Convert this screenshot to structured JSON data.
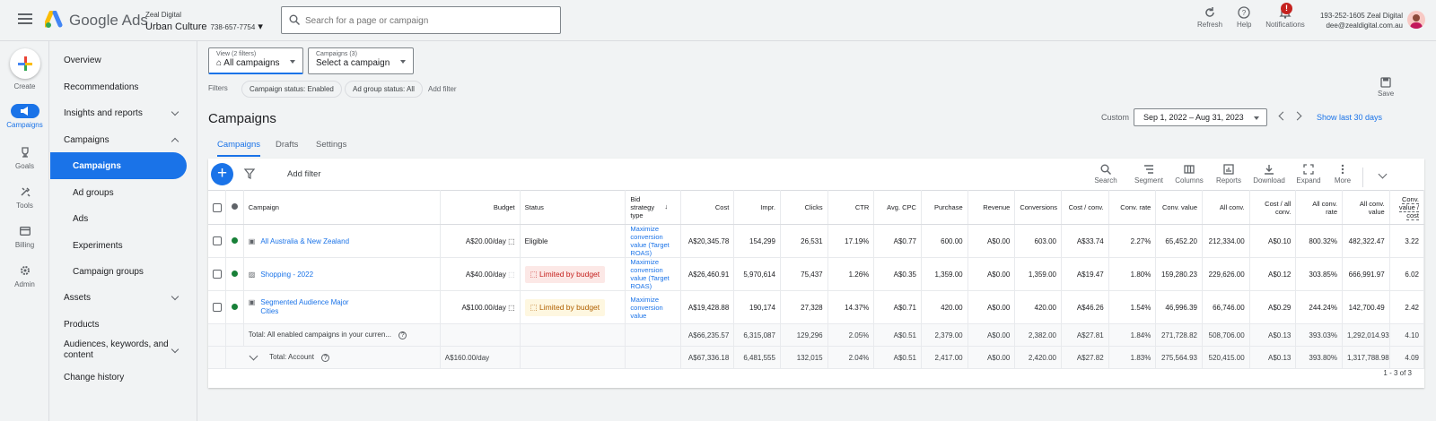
{
  "app": {
    "name": "Google Ads"
  },
  "account": {
    "manager": "Zeal Digital",
    "name": "Urban Culture",
    "id": "738-657-7754"
  },
  "search": {
    "placeholder": "Search for a page or campaign"
  },
  "topbar": {
    "refresh": "Refresh",
    "help": "Help",
    "notifications": "Notifications",
    "notif_count": "!"
  },
  "user": {
    "line1": "193-252-1605 Zeal Digital",
    "line2": "dee@zealdigital.com.au"
  },
  "rail": {
    "create": "Create",
    "campaigns": "Campaigns",
    "goals": "Goals",
    "tools": "Tools",
    "billing": "Billing",
    "admin": "Admin"
  },
  "nav": {
    "overview": "Overview",
    "recommendations": "Recommendations",
    "insights": "Insights and reports",
    "campaigns": "Campaigns",
    "campaigns_sub": "Campaigns",
    "ad_groups": "Ad groups",
    "ads": "Ads",
    "experiments": "Experiments",
    "campaign_groups": "Campaign groups",
    "assets": "Assets",
    "products": "Products",
    "audiences": "Audiences, keywords, and content",
    "change_history": "Change history"
  },
  "view": {
    "label": "View (2 filters)",
    "value": "All campaigns"
  },
  "campaign_select": {
    "label": "Campaigns (3)",
    "value": "Select a campaign"
  },
  "filters": {
    "label": "Filters",
    "chip1": "Campaign status: Enabled",
    "chip2": "Ad group status: All",
    "add": "Add filter"
  },
  "save": "Save",
  "page": {
    "title": "Campaigns"
  },
  "date": {
    "custom": "Custom",
    "range": "Sep 1, 2022 – Aug 31, 2023",
    "show_last": "Show last 30 days"
  },
  "tabs": {
    "campaigns": "Campaigns",
    "drafts": "Drafts",
    "settings": "Settings"
  },
  "toolbar": {
    "add_filter": "Add filter",
    "search": "Search",
    "segment": "Segment",
    "columns": "Columns",
    "reports": "Reports",
    "download": "Download",
    "expand": "Expand",
    "more": "More"
  },
  "columns": {
    "campaign": "Campaign",
    "budget": "Budget",
    "status": "Status",
    "bid": "Bid strategy type",
    "cost": "Cost",
    "impr": "Impr.",
    "clicks": "Clicks",
    "ctr": "CTR",
    "avg_cpc": "Avg. CPC",
    "purchase": "Purchase",
    "revenue": "Revenue",
    "conversions": "Conversions",
    "cost_conv": "Cost / conv.",
    "conv_rate": "Conv. rate",
    "conv_value": "Conv. value",
    "all_conv": "All conv.",
    "cost_all_conv": "Cost / all conv.",
    "all_conv_rate": "All conv. rate",
    "all_conv_value": "All conv. value",
    "conv_value_cost": "Conv. value / cost"
  },
  "rows": [
    {
      "campaign": "All Australia & New Zealand",
      "budget": "A$20.00/day",
      "status": "Eligible",
      "bid": "Maximize conversion value (Target ROAS)",
      "cost": "A$20,345.78",
      "impr": "154,299",
      "clicks": "26,531",
      "ctr": "17.19%",
      "avg_cpc": "A$0.77",
      "purchase": "600.00",
      "revenue": "A$0.00",
      "conversions": "603.00",
      "cost_conv": "A$33.74",
      "conv_rate": "2.27%",
      "conv_value": "65,452.20",
      "all_conv": "212,334.00",
      "cost_all_conv": "A$0.10",
      "all_conv_rate": "800.32%",
      "all_conv_value": "482,322.47",
      "conv_value_cost": "3.22"
    },
    {
      "campaign": "Shopping - 2022",
      "budget": "A$40.00/day",
      "status": "Limited by budget",
      "bid": "Maximize conversion value (Target ROAS)",
      "cost": "A$26,460.91",
      "impr": "5,970,614",
      "clicks": "75,437",
      "ctr": "1.26%",
      "avg_cpc": "A$0.35",
      "purchase": "1,359.00",
      "revenue": "A$0.00",
      "conversions": "1,359.00",
      "cost_conv": "A$19.47",
      "conv_rate": "1.80%",
      "conv_value": "159,280.23",
      "all_conv": "229,626.00",
      "cost_all_conv": "A$0.12",
      "all_conv_rate": "303.85%",
      "all_conv_value": "666,991.97",
      "conv_value_cost": "6.02"
    },
    {
      "campaign": "Segmented Audience Major Cities",
      "budget": "A$100.00/day",
      "status": "Limited by budget",
      "bid": "Maximize conversion value",
      "cost": "A$19,428.88",
      "impr": "190,174",
      "clicks": "27,328",
      "ctr": "14.37%",
      "avg_cpc": "A$0.71",
      "purchase": "420.00",
      "revenue": "A$0.00",
      "conversions": "420.00",
      "cost_conv": "A$46.26",
      "conv_rate": "1.54%",
      "conv_value": "46,996.39",
      "all_conv": "66,746.00",
      "cost_all_conv": "A$0.29",
      "all_conv_rate": "244.24%",
      "all_conv_value": "142,700.49",
      "conv_value_cost": "2.42"
    }
  ],
  "totals": [
    {
      "label": "Total: All enabled campaigns in your curren...",
      "budget": "",
      "cost": "A$66,235.57",
      "impr": "6,315,087",
      "clicks": "129,296",
      "ctr": "2.05%",
      "avg_cpc": "A$0.51",
      "purchase": "2,379.00",
      "revenue": "A$0.00",
      "conversions": "2,382.00",
      "cost_conv": "A$27.81",
      "conv_rate": "1.84%",
      "conv_value": "271,728.82",
      "all_conv": "508,706.00",
      "cost_all_conv": "A$0.13",
      "all_conv_rate": "393.03%",
      "all_conv_value": "1,292,014.93",
      "conv_value_cost": "4.10"
    },
    {
      "label": "Total: Account",
      "budget": "A$160.00/day",
      "cost": "A$67,336.18",
      "impr": "6,481,555",
      "clicks": "132,015",
      "ctr": "2.04%",
      "avg_cpc": "A$0.51",
      "purchase": "2,417.00",
      "revenue": "A$0.00",
      "conversions": "2,420.00",
      "cost_conv": "A$27.82",
      "conv_rate": "1.83%",
      "conv_value": "275,564.93",
      "all_conv": "520,415.00",
      "cost_all_conv": "A$0.13",
      "all_conv_rate": "393.80%",
      "all_conv_value": "1,317,788.98",
      "conv_value_cost": "4.09"
    }
  ],
  "pager": "1 - 3 of 3",
  "colors": {
    "primary": "#1a73e8",
    "eligible_dot": "#188038",
    "limited_bg": "#fce8e6",
    "limited_text": "#c5221f"
  }
}
